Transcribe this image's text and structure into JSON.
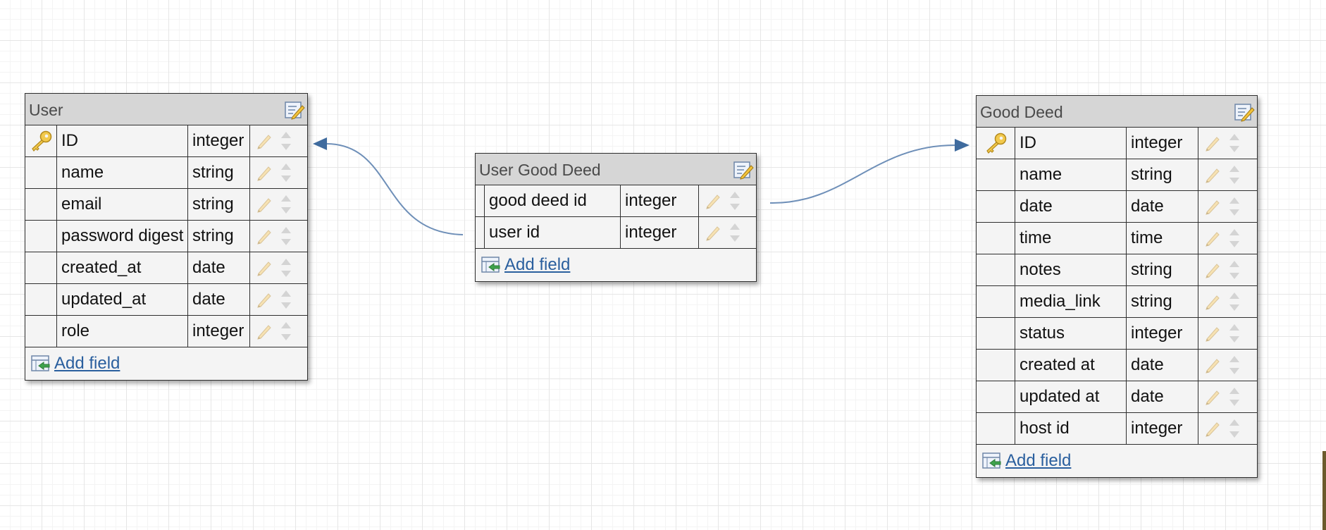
{
  "colors": {
    "connector": "#6e8fb8",
    "arrowhead": "#3f6b9e",
    "header_bg": "#d6d6d6",
    "table_bg": "#f4f4f4",
    "link": "#2a5f9e"
  },
  "tables": [
    {
      "title": "User",
      "add_label": "Add field",
      "fields": [
        {
          "name": "ID",
          "type": "integer",
          "primary_key": true
        },
        {
          "name": "name",
          "type": "string",
          "primary_key": false
        },
        {
          "name": "email",
          "type": "string",
          "primary_key": false
        },
        {
          "name": "password digest",
          "type": "string",
          "primary_key": false
        },
        {
          "name": "created_at",
          "type": "date",
          "primary_key": false
        },
        {
          "name": "updated_at",
          "type": "date",
          "primary_key": false
        },
        {
          "name": "role",
          "type": "integer",
          "primary_key": false
        }
      ]
    },
    {
      "title": "User Good Deed",
      "add_label": "Add field",
      "fields": [
        {
          "name": "good deed id",
          "type": "integer",
          "primary_key": false
        },
        {
          "name": "user id",
          "type": "integer",
          "primary_key": false
        }
      ]
    },
    {
      "title": "Good Deed",
      "add_label": "Add field",
      "fields": [
        {
          "name": "ID",
          "type": "integer",
          "primary_key": true
        },
        {
          "name": "name",
          "type": "string",
          "primary_key": false
        },
        {
          "name": "date",
          "type": "date",
          "primary_key": false
        },
        {
          "name": "time",
          "type": "time",
          "primary_key": false
        },
        {
          "name": "notes",
          "type": "string",
          "primary_key": false
        },
        {
          "name": "media_link",
          "type": "string",
          "primary_key": false
        },
        {
          "name": "status",
          "type": "integer",
          "primary_key": false
        },
        {
          "name": "created at",
          "type": "date",
          "primary_key": false
        },
        {
          "name": "updated at",
          "type": "date",
          "primary_key": false
        },
        {
          "name": "host id",
          "type": "integer",
          "primary_key": false
        }
      ]
    }
  ],
  "relationships": [
    {
      "from_table": "User Good Deed",
      "from_field": "user id",
      "to_table": "User",
      "to_field": "ID"
    },
    {
      "from_table": "User Good Deed",
      "from_field": "good deed id",
      "to_table": "Good Deed",
      "to_field": "ID"
    }
  ]
}
